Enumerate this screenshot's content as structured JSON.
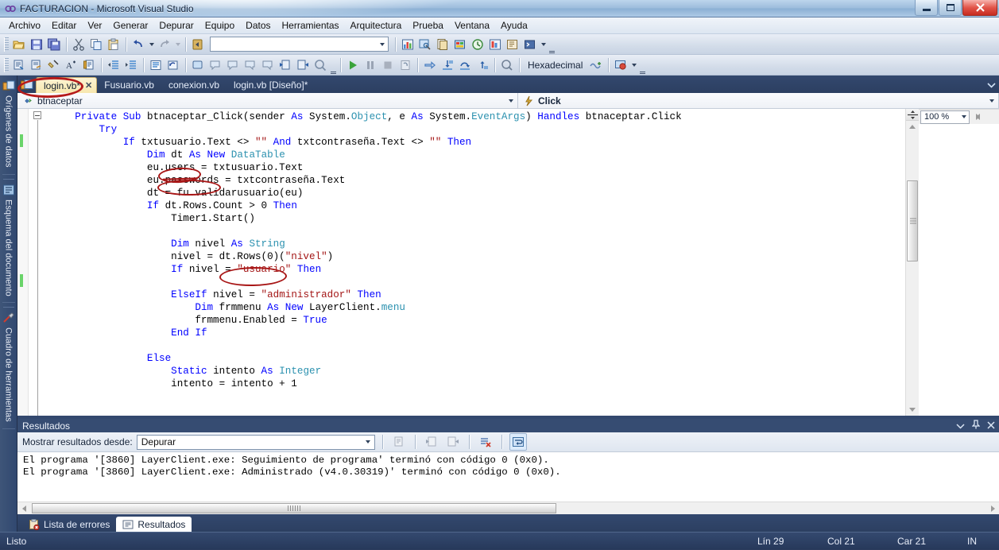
{
  "window": {
    "title": "FACTURACION - Microsoft Visual Studio",
    "minimize_label": "Minimizar",
    "maximize_label": "Restaurar",
    "close_label": "Cerrar"
  },
  "menubar": {
    "items": [
      {
        "label": "Archivo"
      },
      {
        "label": "Editar"
      },
      {
        "label": "Ver"
      },
      {
        "label": "Generar"
      },
      {
        "label": "Depurar"
      },
      {
        "label": "Equipo"
      },
      {
        "label": "Datos"
      },
      {
        "label": "Herramientas"
      },
      {
        "label": "Arquitectura"
      },
      {
        "label": "Prueba"
      },
      {
        "label": "Ventana"
      },
      {
        "label": "Ayuda"
      }
    ]
  },
  "toolbar_standard": {
    "combo_value": "",
    "icons": [
      "open-folder-icon",
      "save-icon",
      "save-all-icon",
      "cut-icon",
      "copy-icon",
      "paste-icon",
      "undo-icon",
      "redo-icon",
      "navigate-backward-icon",
      "solution-explorer-icon",
      "properties-window-icon",
      "object-browser-icon",
      "toolbox-icon",
      "history-icon",
      "team-explorer-icon",
      "class-view-icon",
      "command-window-icon"
    ]
  },
  "toolbar_debug": {
    "hex_label": "Hexadecimal",
    "icons": [
      "comment-icon",
      "uncomment-icon",
      "bookmark-icon",
      "font-size-icon",
      "snippet-icon",
      "decrease-indent-icon",
      "increase-indent-icon",
      "list-members-icon",
      "undo-checkout-icon",
      "breakpoint-icon",
      "callout1-icon",
      "callout2-icon",
      "callout3-icon",
      "callout4-icon",
      "step-over-all-icon",
      "step-into-all-icon",
      "watch-icon",
      "start-debug-icon",
      "pause-icon",
      "stop-icon",
      "restart-icon",
      "show-next-statement-icon",
      "step-into-icon",
      "step-over-icon",
      "step-out-icon",
      "breakpoints-window-icon",
      "hexadecimal-icon",
      "threads-icon",
      "show-output-icon"
    ]
  },
  "left_rail": {
    "items": [
      {
        "label": "Orígenes de datos",
        "icon": "data-sources-icon"
      },
      {
        "label": "Esquema del documento",
        "icon": "document-outline-icon"
      },
      {
        "label": "Cuadro de herramientas",
        "icon": "toolbox-icon"
      }
    ]
  },
  "tabs": {
    "items": [
      {
        "label": "login.vb*",
        "active": true,
        "closable": true
      },
      {
        "label": "Fusuario.vb",
        "active": false,
        "closable": false
      },
      {
        "label": "conexion.vb",
        "active": false,
        "closable": false
      },
      {
        "label": "login.vb [Diseño]*",
        "active": false,
        "closable": false
      }
    ],
    "close_glyph": "✕"
  },
  "navbars": {
    "class_combo": "btnaceptar",
    "member_combo": "Click",
    "class_icon": "method-icon",
    "member_icon": "event-lightning-icon"
  },
  "editor": {
    "zoom_level": "100 %",
    "code_lines": [
      [
        {
          "t": "    ",
          "c": "id"
        },
        {
          "t": "Private",
          "c": "kw"
        },
        {
          "t": " ",
          "c": "id"
        },
        {
          "t": "Sub",
          "c": "kw"
        },
        {
          "t": " btnaceptar_Click(sender ",
          "c": "id"
        },
        {
          "t": "As",
          "c": "kw"
        },
        {
          "t": " System.",
          "c": "id"
        },
        {
          "t": "Object",
          "c": "ty"
        },
        {
          "t": ", e ",
          "c": "id"
        },
        {
          "t": "As",
          "c": "kw"
        },
        {
          "t": " System.",
          "c": "id"
        },
        {
          "t": "EventArgs",
          "c": "ty"
        },
        {
          "t": ") ",
          "c": "id"
        },
        {
          "t": "Handles",
          "c": "kw"
        },
        {
          "t": " btnaceptar.Click",
          "c": "id"
        }
      ],
      [
        {
          "t": "        ",
          "c": "id"
        },
        {
          "t": "Try",
          "c": "kw"
        }
      ],
      [
        {
          "t": "            ",
          "c": "id"
        },
        {
          "t": "If",
          "c": "kw"
        },
        {
          "t": " txtusuario.Text <> ",
          "c": "id"
        },
        {
          "t": "\"\"",
          "c": "st"
        },
        {
          "t": " ",
          "c": "id"
        },
        {
          "t": "And",
          "c": "kw"
        },
        {
          "t": " txtcontraseña.Text <> ",
          "c": "id"
        },
        {
          "t": "\"\"",
          "c": "st"
        },
        {
          "t": " ",
          "c": "id"
        },
        {
          "t": "Then",
          "c": "kw"
        }
      ],
      [
        {
          "t": "                ",
          "c": "id"
        },
        {
          "t": "Dim",
          "c": "kw"
        },
        {
          "t": " dt ",
          "c": "id"
        },
        {
          "t": "As",
          "c": "kw"
        },
        {
          "t": " ",
          "c": "id"
        },
        {
          "t": "New",
          "c": "kw"
        },
        {
          "t": " ",
          "c": "id"
        },
        {
          "t": "DataTable",
          "c": "ty"
        }
      ],
      [
        {
          "t": "                eu.users = txtusuario.Text",
          "c": "id"
        }
      ],
      [
        {
          "t": "                eu.passwords = txtcontraseña.Text",
          "c": "id"
        }
      ],
      [
        {
          "t": "                dt = fu.validarusuario(eu)",
          "c": "id"
        }
      ],
      [
        {
          "t": "                ",
          "c": "id"
        },
        {
          "t": "If",
          "c": "kw"
        },
        {
          "t": " dt.Rows.Count > 0 ",
          "c": "id"
        },
        {
          "t": "Then",
          "c": "kw"
        }
      ],
      [
        {
          "t": "                    Timer1.Start()",
          "c": "id"
        }
      ],
      [
        {
          "t": "",
          "c": "id"
        }
      ],
      [
        {
          "t": "                    ",
          "c": "id"
        },
        {
          "t": "Dim",
          "c": "kw"
        },
        {
          "t": " nivel ",
          "c": "id"
        },
        {
          "t": "As",
          "c": "kw"
        },
        {
          "t": " ",
          "c": "id"
        },
        {
          "t": "String",
          "c": "ty"
        }
      ],
      [
        {
          "t": "                    nivel = dt.Rows(0)(",
          "c": "id"
        },
        {
          "t": "\"nivel\"",
          "c": "st"
        },
        {
          "t": ")",
          "c": "id"
        }
      ],
      [
        {
          "t": "                    ",
          "c": "id"
        },
        {
          "t": "If",
          "c": "kw"
        },
        {
          "t": " nivel = ",
          "c": "id"
        },
        {
          "t": "\"usuario\"",
          "c": "st"
        },
        {
          "t": " ",
          "c": "id"
        },
        {
          "t": "Then",
          "c": "kw"
        }
      ],
      [
        {
          "t": "",
          "c": "id"
        }
      ],
      [
        {
          "t": "                    ",
          "c": "id"
        },
        {
          "t": "ElseIf",
          "c": "kw"
        },
        {
          "t": " nivel = ",
          "c": "id"
        },
        {
          "t": "\"administrador\"",
          "c": "st"
        },
        {
          "t": " ",
          "c": "id"
        },
        {
          "t": "Then",
          "c": "kw"
        }
      ],
      [
        {
          "t": "                        ",
          "c": "id"
        },
        {
          "t": "Dim",
          "c": "kw"
        },
        {
          "t": " frmmenu ",
          "c": "id"
        },
        {
          "t": "As",
          "c": "kw"
        },
        {
          "t": " ",
          "c": "id"
        },
        {
          "t": "New",
          "c": "kw"
        },
        {
          "t": " LayerClient.",
          "c": "id"
        },
        {
          "t": "menu",
          "c": "ty"
        }
      ],
      [
        {
          "t": "                        frmmenu.Enabled = ",
          "c": "id"
        },
        {
          "t": "True",
          "c": "kw"
        }
      ],
      [
        {
          "t": "                    ",
          "c": "id"
        },
        {
          "t": "End If",
          "c": "kw"
        }
      ],
      [
        {
          "t": "",
          "c": "id"
        }
      ],
      [
        {
          "t": "                ",
          "c": "id"
        },
        {
          "t": "Else",
          "c": "kw"
        }
      ],
      [
        {
          "t": "                    ",
          "c": "id"
        },
        {
          "t": "Static",
          "c": "kw"
        },
        {
          "t": " intento ",
          "c": "id"
        },
        {
          "t": "As",
          "c": "kw"
        },
        {
          "t": " ",
          "c": "id"
        },
        {
          "t": "Integer",
          "c": "ty"
        }
      ],
      [
        {
          "t": "                    intento = intento + 1",
          "c": "id"
        }
      ]
    ]
  },
  "output_pane": {
    "title": "Resultados",
    "filter_label": "Mostrar resultados desde:",
    "filter_value": "Depurar",
    "lines": [
      "El programa '[3860] LayerClient.exe: Seguimiento de programa' terminó con código 0 (0x0).",
      "El programa '[3860] LayerClient.exe: Administrado (v4.0.30319)' terminó con código 0 (0x0)."
    ],
    "tools": {
      "dropdown": "▾",
      "pin": "pin-icon",
      "close": "✕"
    },
    "toolbar_icons": [
      "find-message-icon",
      "go-to-previous-icon",
      "go-to-next-icon",
      "clear-all-icon",
      "toggle-wordwrap-icon"
    ]
  },
  "pane_tabs": {
    "items": [
      {
        "label": "Lista de errores",
        "icon": "error-list-icon",
        "active": false
      },
      {
        "label": "Resultados",
        "icon": "output-icon",
        "active": true
      }
    ]
  },
  "statusbar": {
    "state": "Listo",
    "line": "Lín 29",
    "column": "Col 21",
    "character": "Car 21",
    "insert_mode": "IN"
  },
  "annotations": {
    "circles": [
      {
        "target": "login.vb* tab"
      },
      {
        "target": "users"
      },
      {
        "target": "passwords"
      },
      {
        "target": "\"usuario\""
      }
    ],
    "color": "#b51a1a"
  }
}
